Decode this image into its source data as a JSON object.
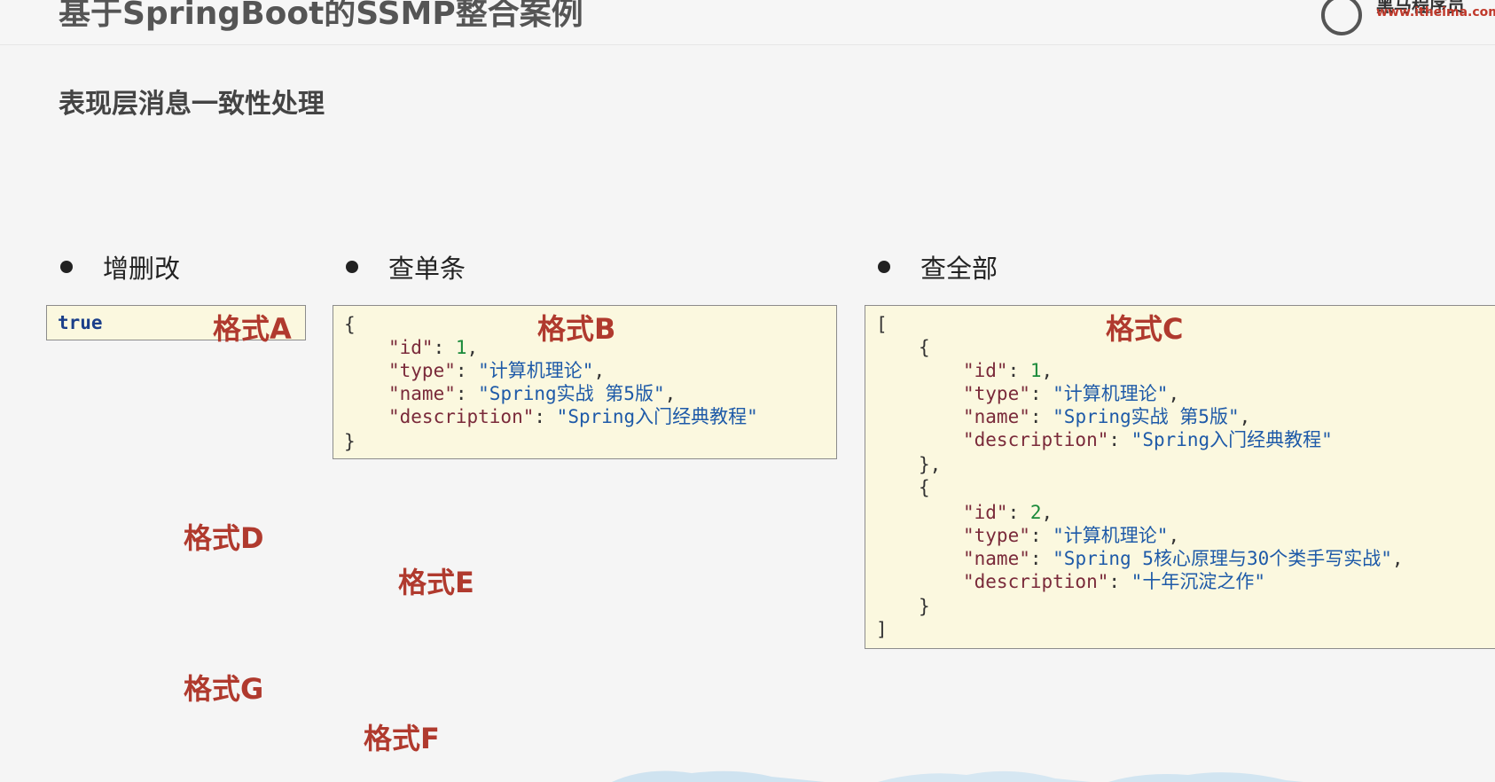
{
  "header": {
    "title": "基于SpringBoot的SSMP整合案例",
    "logo_name": "黑马程序员",
    "logo_url": "www.itheima.com"
  },
  "subtitle": "表现层消息一致性处理",
  "sections": [
    {
      "label": "增删改"
    },
    {
      "label": "查单条"
    },
    {
      "label": "查全部"
    }
  ],
  "box_a": {
    "value": "true",
    "format_label": "格式A"
  },
  "box_b": {
    "format_label": "格式B",
    "item": {
      "id": "1",
      "type": "\"计算机理论\"",
      "name": "\"Spring实战 第5版\"",
      "description": "\"Spring入门经典教程\""
    }
  },
  "box_c": {
    "format_label": "格式C",
    "items": [
      {
        "id": "1",
        "type": "\"计算机理论\"",
        "name": "\"Spring实战 第5版\"",
        "description": "\"Spring入门经典教程\""
      },
      {
        "id": "2",
        "type": "\"计算机理论\"",
        "name": "\"Spring 5核心原理与30个类手写实战\"",
        "description": "\"十年沉淀之作\""
      }
    ]
  },
  "json_keys": {
    "id": "\"id\"",
    "type": "\"type\"",
    "name": "\"name\"",
    "description": "\"description\""
  },
  "floating_formats": {
    "d": "格式D",
    "e": "格式E",
    "g": "格式G",
    "f": "格式F"
  },
  "colors": {
    "format_label": "#b03a2e",
    "code_background": "#fbf8df",
    "json_key": "#7a2a3a",
    "json_string": "#1e5aa8",
    "json_number": "#1a8a3a"
  }
}
